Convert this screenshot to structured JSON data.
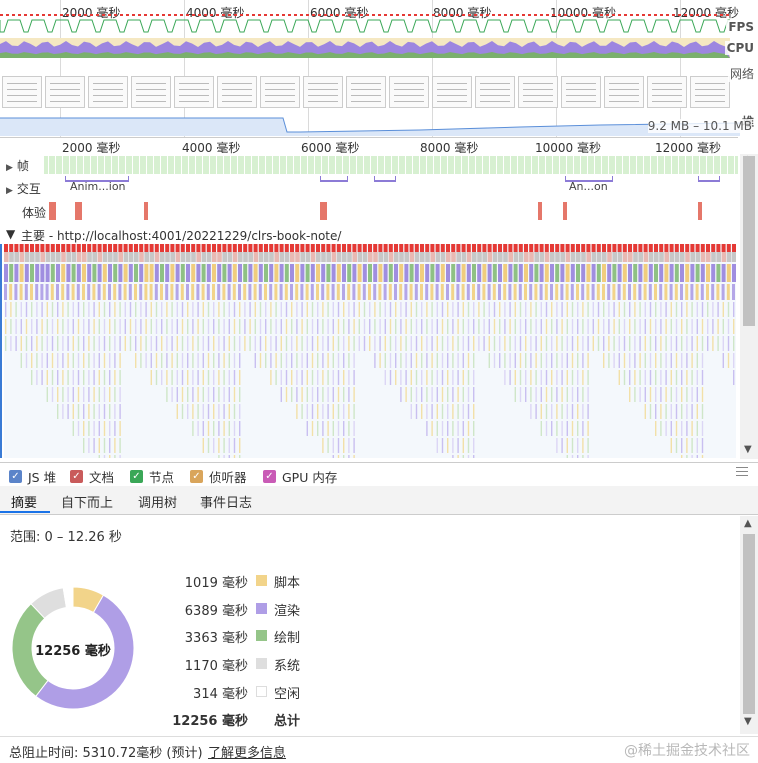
{
  "overview": {
    "ticks": [
      "2000 毫秒",
      "4000 毫秒",
      "6000 毫秒",
      "8000 毫秒",
      "10000 毫秒",
      "12000 毫秒"
    ],
    "fps_label": "FPS",
    "cpu_label": "CPU",
    "net_label": "网络",
    "heap_label": "堆",
    "heap_range": "9.2 MB – 10.1 MB"
  },
  "ruler": {
    "ticks": [
      "2000 毫秒",
      "4000 毫秒",
      "6000 毫秒",
      "8000 毫秒",
      "10000 毫秒",
      "12000 毫秒"
    ]
  },
  "tracks": {
    "frames": "帧",
    "interactions": "交互",
    "experience": "体验",
    "main": "主要 - http://localhost:4001/20221229/clrs-book-note/",
    "interaction_labels": [
      "Anim...ion",
      "An...on"
    ]
  },
  "legend": {
    "items": [
      {
        "label": "JS 堆",
        "color": "#5b84c9"
      },
      {
        "label": "文档",
        "color": "#c95b5b"
      },
      {
        "label": "节点",
        "color": "#3aa757"
      },
      {
        "label": "侦听器",
        "color": "#d9a55b"
      },
      {
        "label": "GPU 内存",
        "color": "#c95bb6"
      }
    ]
  },
  "tabs": [
    "摘要",
    "自下而上",
    "调用树",
    "事件日志"
  ],
  "summary": {
    "range": "范围: 0 – 12.26 秒",
    "total_center": "12256 毫秒",
    "categories": [
      {
        "value": "1019 毫秒",
        "name": "脚本",
        "ms": 1019,
        "color": "#f2d48a"
      },
      {
        "value": "6389 毫秒",
        "name": "渲染",
        "ms": 6389,
        "color": "#af9ee6"
      },
      {
        "value": "3363 毫秒",
        "name": "绘制",
        "ms": 3363,
        "color": "#95c589"
      },
      {
        "value": "1170 毫秒",
        "name": "系统",
        "ms": 1170,
        "color": "#dedede"
      },
      {
        "value": "314 毫秒",
        "name": "空闲",
        "ms": 314,
        "color": "#ffffff"
      }
    ],
    "total_value": "12256 毫秒",
    "total_name": "总计"
  },
  "footer": {
    "blocking": "总阻止时间:  5310.72毫秒 (预计)",
    "learn_more": "了解更多信息"
  },
  "watermark": "@稀土掘金技术社区"
}
